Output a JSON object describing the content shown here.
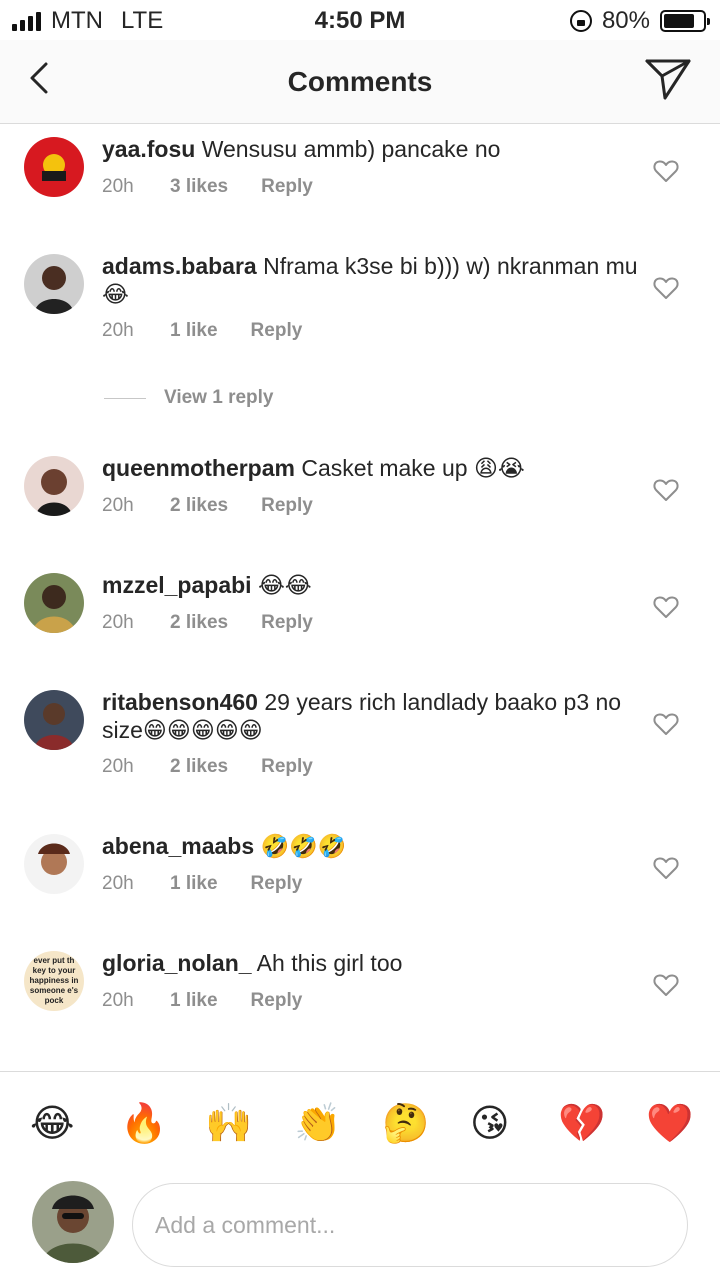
{
  "status_bar": {
    "carrier": "MTN",
    "network": "LTE",
    "time": "4:50 PM",
    "battery": "80%",
    "battery_level": 0.8
  },
  "header": {
    "title": "Comments",
    "back_icon": "chevron-left-icon",
    "send_icon": "paper-plane-icon"
  },
  "comments": [
    {
      "username": "yaa.fosu",
      "text": "Wensusu ammb) pancake no",
      "time": "20h",
      "likes": "3 likes",
      "reply": "Reply"
    },
    {
      "username": "adams.babara",
      "text": "Nframa k3se bi b))) w) nkranman mu 😂",
      "time": "20h",
      "likes": "1 like",
      "reply": "Reply",
      "view_replies": "View 1 reply"
    },
    {
      "username": "queenmotherpam",
      "text": "Casket make up 😩😭",
      "time": "20h",
      "likes": "2 likes",
      "reply": "Reply"
    },
    {
      "username": "mzzel_papabi",
      "text": "😂😂",
      "time": "20h",
      "likes": "2 likes",
      "reply": "Reply"
    },
    {
      "username": "ritabenson460",
      "text": "29 years rich landlady baako p3 no size😁😁😁😁😁",
      "time": "20h",
      "likes": "2 likes",
      "reply": "Reply"
    },
    {
      "username": "abena_maabs",
      "text": "🤣🤣🤣",
      "time": "20h",
      "likes": "1 like",
      "reply": "Reply"
    },
    {
      "username": "gloria_nolan_",
      "text": "Ah this girl too",
      "time": "20h",
      "likes": "1 like",
      "reply": "Reply",
      "avatar_text": "ever put th key to your happiness in someone e's pock"
    }
  ],
  "emoji_bar": [
    "😂",
    "🔥",
    "🙌",
    "👏",
    "🤔",
    "😘",
    "💔",
    "❤️"
  ],
  "composer": {
    "placeholder": "Add a comment..."
  },
  "colors": {
    "text": "#262626",
    "secondary": "#8e8e8e",
    "divider": "#dbdbdb"
  }
}
